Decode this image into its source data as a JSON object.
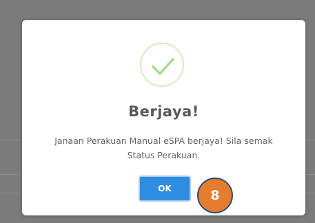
{
  "dialog": {
    "title": "Berjaya!",
    "message": "Janaan Perakuan Manual eSPA berjaya! Sila semak Status Perakuan.",
    "ok_label": "OK",
    "icon": "checkmark-success-icon"
  },
  "annotation": {
    "step_number": "8"
  },
  "colors": {
    "overlay": "#7b7b7b",
    "success": "#a5dc86",
    "button": "#2e8de0",
    "badge": "#e47d2e",
    "badge_border": "#2f4a7a"
  }
}
